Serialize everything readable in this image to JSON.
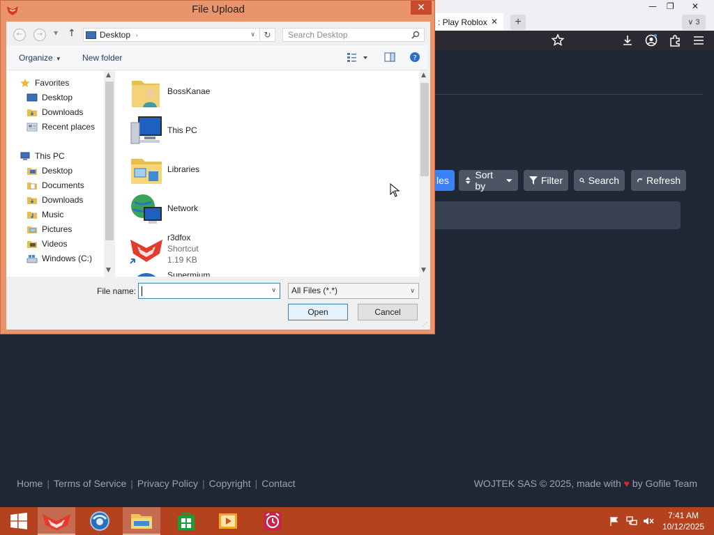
{
  "browser": {
    "tab_label": ": Play Roblox",
    "tab_close": "✕",
    "new_tab": "+",
    "tab_count": "3",
    "tab_count_chevron": "∨",
    "window_controls": [
      "—",
      "❐",
      "✕"
    ]
  },
  "page": {
    "toolbar_buttons": [
      {
        "label": "les"
      },
      {
        "label": "Sort by",
        "icon": "sort-icon"
      },
      {
        "label": "Filter",
        "icon": "filter-icon"
      },
      {
        "label": "Search",
        "icon": "search-icon"
      },
      {
        "label": "Refresh",
        "icon": "refresh-icon"
      }
    ],
    "footer_links": [
      "Home",
      "Terms of Service",
      "Privacy Policy",
      "Copyright",
      "Contact"
    ],
    "footer_separator": "|",
    "copyright_pre": "WOJTEK SAS © 2025, made with ",
    "copyright_heart": "♥",
    "copyright_post": " by Gofile Team",
    "colors": {
      "background": "#1f2633",
      "accent": "#3b82f6",
      "button": "#4b5563"
    }
  },
  "dialog": {
    "title": "File Upload",
    "close": "✕",
    "address": "Desktop",
    "address_arrow": "›",
    "search_placeholder": "Search Desktop",
    "commands": {
      "organize": "Organize",
      "new_folder": "New folder"
    },
    "nav": {
      "favorites_header": "Favorites",
      "favorites": [
        "Desktop",
        "Downloads",
        "Recent places"
      ],
      "this_pc_header": "This PC",
      "this_pc": [
        "Desktop",
        "Documents",
        "Downloads",
        "Music",
        "Pictures",
        "Videos",
        "Windows (C:)"
      ]
    },
    "files": [
      {
        "name": "BossKanae",
        "icon": "user-folder-icon"
      },
      {
        "name": "This PC",
        "icon": "computer-icon"
      },
      {
        "name": "Libraries",
        "icon": "libraries-icon"
      },
      {
        "name": "Network",
        "icon": "network-icon"
      },
      {
        "name": "r3dfox",
        "type": "Shortcut",
        "size": "1.19 KB",
        "icon": "r3dfox-icon"
      },
      {
        "name": "Supermium",
        "icon": "supermium-icon"
      }
    ],
    "file_name_label": "File name:",
    "file_name_value": "",
    "file_type": "All Files (*.*)",
    "open_label": "Open",
    "cancel_label": "Cancel",
    "colors": {
      "frame": "#e9946a",
      "close": "#c7492e"
    }
  },
  "taskbar": {
    "time": "7:41 AM",
    "date": "10/12/2025",
    "color": "#b5421f",
    "apps": [
      "windows-start-icon",
      "r3dfox-icon",
      "supermium-icon",
      "file-explorer-icon",
      "store-icon",
      "media-player-icon",
      "alarm-clock-icon"
    ]
  }
}
